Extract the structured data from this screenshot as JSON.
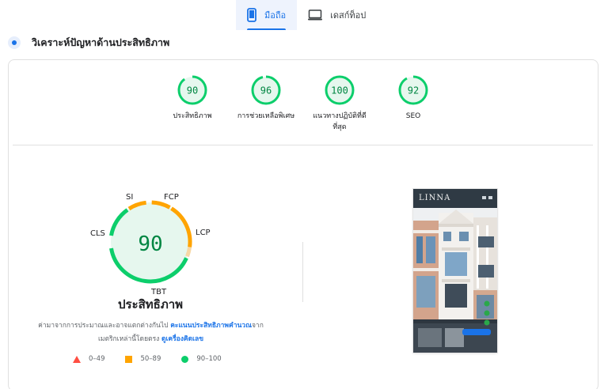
{
  "tabs": [
    {
      "label": "มือถือ",
      "icon": "mobile-icon",
      "active": true
    },
    {
      "label": "เดสก์ท็อป",
      "icon": "desktop-icon",
      "active": false
    }
  ],
  "section": {
    "title": "วิเคราะห์ปัญหาด้านประสิทธิภาพ"
  },
  "colors": {
    "pass": "#0cce6b",
    "average": "#ffa400",
    "fail": "#ff4e42",
    "accent": "#1a73e8",
    "pass_text": "#018642"
  },
  "scores": [
    {
      "value": "90",
      "label": "ประสิทธิภาพ",
      "fraction": 0.9
    },
    {
      "value": "96",
      "label": "การช่วยเหลือพิเศษ",
      "fraction": 0.96
    },
    {
      "value": "100",
      "label": "แนวทางปฏิบัติที่ดี",
      "label2": "ที่สุด",
      "fraction": 1.0
    },
    {
      "value": "92",
      "label": "SEO",
      "fraction": 0.92
    }
  ],
  "performance": {
    "score": "90",
    "title": "ประสิทธิภาพ",
    "metrics": {
      "si": "SI",
      "fcp": "FCP",
      "lcp": "LCP",
      "tbt": "TBT",
      "cls": "CLS"
    },
    "desc_1": "ค่ามาจากการประมาณและอาจแตกต่างกันไป ",
    "desc_link_1": "คะแนนประสิทธิภาพคำนวณ",
    "desc_2": "จาก",
    "desc_3": "เมตริกเหล่านี้โดยตรง ",
    "desc_link_2": "ดูเครื่องคิดเลข"
  },
  "legend": [
    {
      "range": "0–49",
      "icon": "triangle-icon"
    },
    {
      "range": "50–89",
      "icon": "square-icon"
    },
    {
      "range": "90–100",
      "icon": "circle-icon"
    }
  ],
  "screenshot": {
    "brand": "LINNA"
  }
}
